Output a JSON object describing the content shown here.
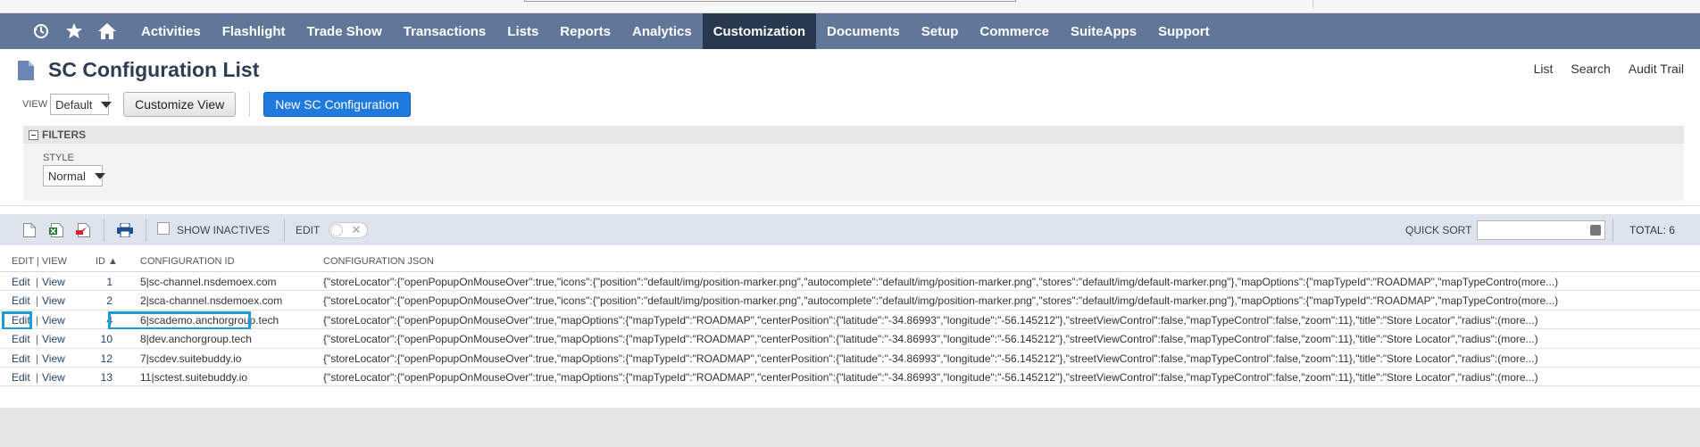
{
  "nav": {
    "items": [
      {
        "label": "Activities",
        "active": false
      },
      {
        "label": "Flashlight",
        "active": false
      },
      {
        "label": "Trade Show",
        "active": false
      },
      {
        "label": "Transactions",
        "active": false
      },
      {
        "label": "Lists",
        "active": false
      },
      {
        "label": "Reports",
        "active": false
      },
      {
        "label": "Analytics",
        "active": false
      },
      {
        "label": "Customization",
        "active": true
      },
      {
        "label": "Documents",
        "active": false
      },
      {
        "label": "Setup",
        "active": false
      },
      {
        "label": "Commerce",
        "active": false
      },
      {
        "label": "SuiteApps",
        "active": false
      },
      {
        "label": "Support",
        "active": false
      }
    ],
    "icons": [
      "recent-records-icon",
      "star-icon",
      "home-icon"
    ]
  },
  "page": {
    "title": "SC Configuration List",
    "links": [
      "List",
      "Search",
      "Audit Trail"
    ]
  },
  "view": {
    "label": "VIEW",
    "selected": "Default",
    "customize_label": "Customize View",
    "new_label": "New SC Configuration"
  },
  "filters": {
    "header": "FILTERS",
    "style_label": "STYLE",
    "style_selected": "Normal"
  },
  "toolbar": {
    "show_inactives": "SHOW INACTIVES",
    "edit_label": "EDIT",
    "quick_sort": "QUICK SORT",
    "total": "TOTAL: 6"
  },
  "table": {
    "headers": {
      "edit_view": "EDIT | VIEW",
      "id": "ID ▲",
      "configuration_id": "CONFIGURATION ID",
      "configuration_json": "CONFIGURATION JSON"
    },
    "edit_text": "Edit",
    "pipe": "|",
    "view_text": "View",
    "rows": [
      {
        "id": "1",
        "config_id": "5|sc-channel.nsdemoex.com",
        "json": "{\"storeLocator\":{\"openPopupOnMouseOver\":true,\"icons\":{\"position\":\"default/img/position-marker.png\",\"autocomplete\":\"default/img/position-marker.png\",\"stores\":\"default/img/default-marker.png\"},\"mapOptions\":{\"mapTypeId\":\"ROADMAP\",\"mapTypeContro(more...)"
      },
      {
        "id": "2",
        "config_id": "2|sca-channel.nsdemoex.com",
        "json": "{\"storeLocator\":{\"openPopupOnMouseOver\":true,\"icons\":{\"position\":\"default/img/position-marker.png\",\"autocomplete\":\"default/img/position-marker.png\",\"stores\":\"default/img/default-marker.png\"},\"mapOptions\":{\"mapTypeId\":\"ROADMAP\",\"mapTypeContro(more...)"
      },
      {
        "id": "4",
        "config_id": "6|scademo.anchorgroup.tech",
        "json": "{\"storeLocator\":{\"openPopupOnMouseOver\":true,\"mapOptions\":{\"mapTypeId\":\"ROADMAP\",\"centerPosition\":{\"latitude\":\"-34.86993\",\"longitude\":\"-56.145212\"},\"streetViewControl\":false,\"mapTypeControl\":false,\"zoom\":11},\"title\":\"Store Locator\",\"radius\":(more...)"
      },
      {
        "id": "10",
        "config_id": "8|dev.anchorgroup.tech",
        "json": "{\"storeLocator\":{\"openPopupOnMouseOver\":true,\"mapOptions\":{\"mapTypeId\":\"ROADMAP\",\"centerPosition\":{\"latitude\":\"-34.86993\",\"longitude\":\"-56.145212\"},\"streetViewControl\":false,\"mapTypeControl\":false,\"zoom\":11},\"title\":\"Store Locator\",\"radius\":(more...)"
      },
      {
        "id": "12",
        "config_id": "7|scdev.suitebuddy.io",
        "json": "{\"storeLocator\":{\"openPopupOnMouseOver\":true,\"mapOptions\":{\"mapTypeId\":\"ROADMAP\",\"centerPosition\":{\"latitude\":\"-34.86993\",\"longitude\":\"-56.145212\"},\"streetViewControl\":false,\"mapTypeControl\":false,\"zoom\":11},\"title\":\"Store Locator\",\"radius\":(more...)"
      },
      {
        "id": "13",
        "config_id": "11|sctest.suitebuddy.io",
        "json": "{\"storeLocator\":{\"openPopupOnMouseOver\":true,\"mapOptions\":{\"mapTypeId\":\"ROADMAP\",\"centerPosition\":{\"latitude\":\"-34.86993\",\"longitude\":\"-56.145212\"},\"streetViewControl\":false,\"mapTypeControl\":false,\"zoom\":11},\"title\":\"Store Locator\",\"radius\":(more...)"
      }
    ]
  },
  "colors": {
    "nav_bg": "#607799",
    "nav_active": "#27384f",
    "primary_button": "#1f7ae0",
    "highlight": "#1a9dd6"
  }
}
